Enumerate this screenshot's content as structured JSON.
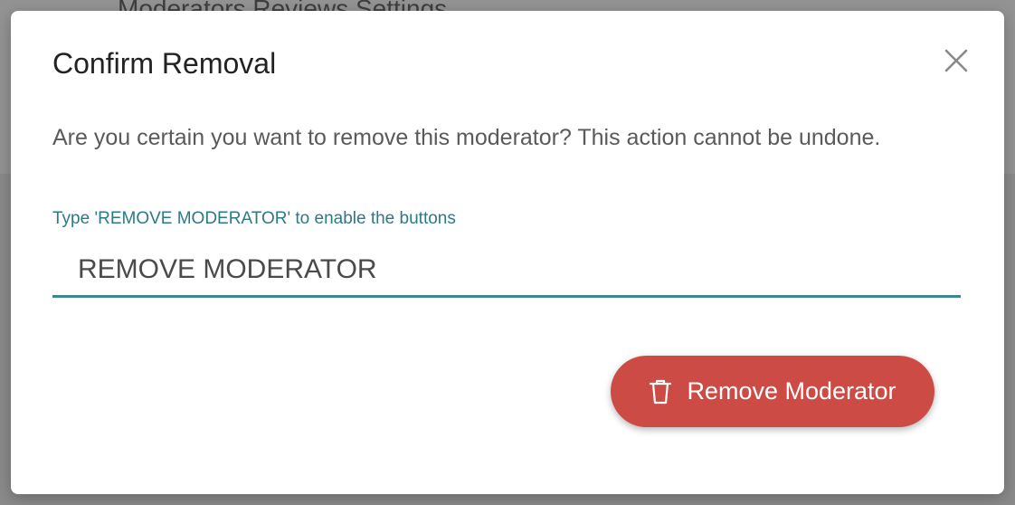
{
  "background": {
    "visible_text": "Moderators  Reviews  Settings"
  },
  "dialog": {
    "title": "Confirm Removal",
    "close_icon": "close-icon",
    "message": "Are you certain you want to remove this moderator? This action cannot be undone.",
    "field": {
      "label": "Type 'REMOVE MODERATOR' to enable the buttons",
      "value": "REMOVE MODERATOR"
    },
    "remove_button": {
      "label": "Remove Moderator",
      "icon": "trash-icon",
      "color": "#cd4b45"
    }
  },
  "colors": {
    "accent": "#2c7a86",
    "danger": "#cd4b45"
  }
}
